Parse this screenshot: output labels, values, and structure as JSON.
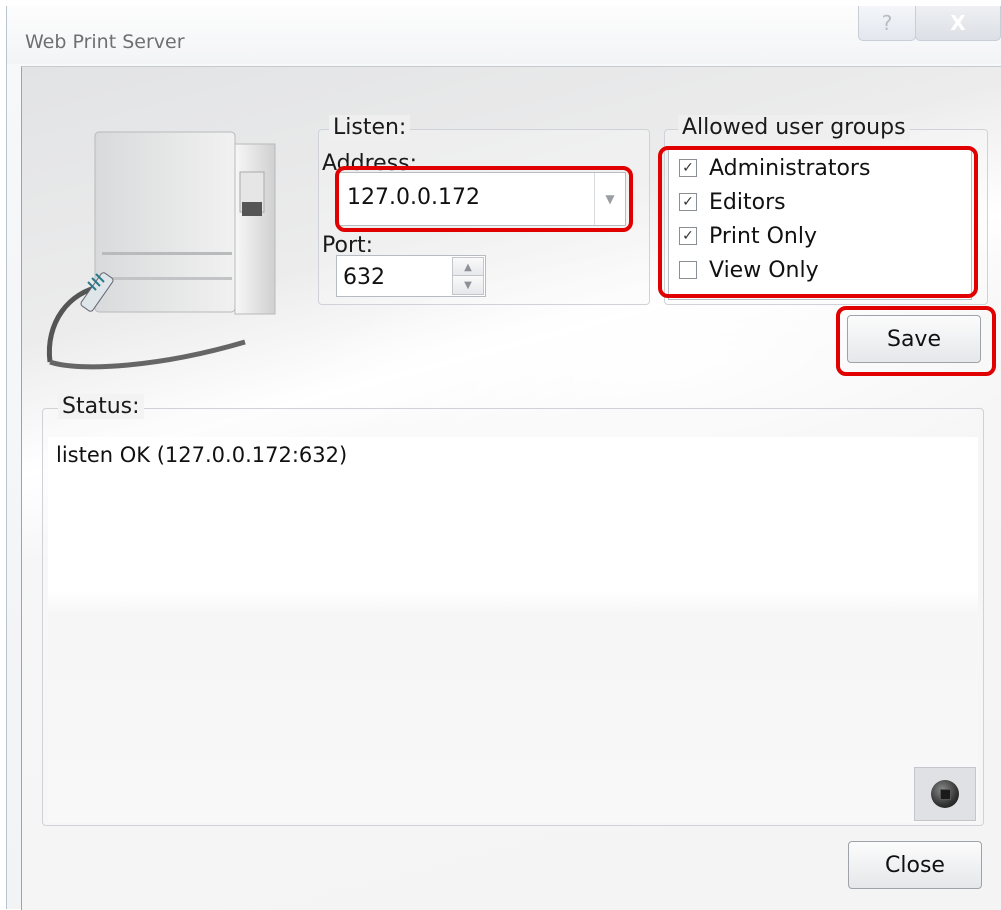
{
  "window": {
    "title": "Web Print Server",
    "help_glyph": "?",
    "close_glyph": "X"
  },
  "listen": {
    "legend": "Listen:",
    "address_label": "Address:",
    "address_value": "127.0.0.172",
    "port_label": "Port:",
    "port_value": "632"
  },
  "groups": {
    "legend": "Allowed user groups",
    "items": [
      {
        "label": "Administrators",
        "checked": true
      },
      {
        "label": "Editors",
        "checked": true
      },
      {
        "label": "Print Only",
        "checked": true
      },
      {
        "label": "View Only",
        "checked": false
      }
    ]
  },
  "buttons": {
    "save": "Save",
    "close": "Close"
  },
  "status": {
    "legend": "Status:",
    "text": "listen OK (127.0.0.172:632)"
  },
  "icons": {
    "printer": "printer-with-network-cable-icon",
    "stop": "stop-icon",
    "dropdown": "chevron-down-icon",
    "spin_up": "spin-up-icon",
    "spin_down": "spin-down-icon"
  },
  "colors": {
    "highlight": "#e00000",
    "title_text": "#6f6f6f"
  }
}
